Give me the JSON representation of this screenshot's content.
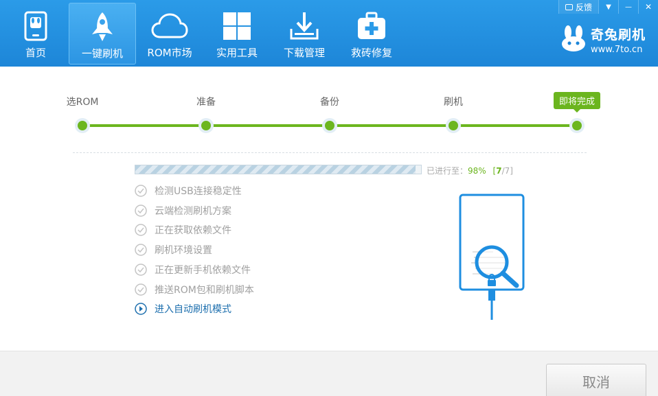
{
  "nav": {
    "items": [
      {
        "label": "首页",
        "icon": "phone-icon"
      },
      {
        "label": "一键刷机",
        "icon": "rocket-icon"
      },
      {
        "label": "ROM市场",
        "icon": "cloud-icon"
      },
      {
        "label": "实用工具",
        "icon": "grid-icon"
      },
      {
        "label": "下载管理",
        "icon": "download-icon"
      },
      {
        "label": "救砖修复",
        "icon": "first-aid-icon"
      }
    ],
    "active_index": 1
  },
  "window": {
    "feedback_label": "反馈",
    "menu_glyph": "▼",
    "minimize_glyph": "—",
    "close_glyph": "✕"
  },
  "brand": {
    "name": "奇兔刷机",
    "url": "www.7to.cn"
  },
  "steps": {
    "items": [
      "选ROM",
      "准备",
      "备份",
      "刷机",
      "即将完成"
    ],
    "current_index": 4
  },
  "progress": {
    "percent": 98,
    "prefix": "已进行至：",
    "percent_text": "98%",
    "count_open": "[",
    "count_done": "7",
    "count_total": "/7]"
  },
  "tasks": [
    {
      "label": "检测USB连接稳定性",
      "state": "done"
    },
    {
      "label": "云端检测刷机方案",
      "state": "done"
    },
    {
      "label": "正在获取依赖文件",
      "state": "done"
    },
    {
      "label": "刷机环境设置",
      "state": "done"
    },
    {
      "label": "正在更新手机依赖文件",
      "state": "done"
    },
    {
      "label": "推送ROM包和刷机脚本",
      "state": "done"
    },
    {
      "label": "进入自动刷机模式",
      "state": "current"
    }
  ],
  "footer": {
    "cancel_label": "取消"
  },
  "colors": {
    "header": "#1d86d8",
    "accent_green": "#6bb51e",
    "current_task": "#1d6fae"
  }
}
